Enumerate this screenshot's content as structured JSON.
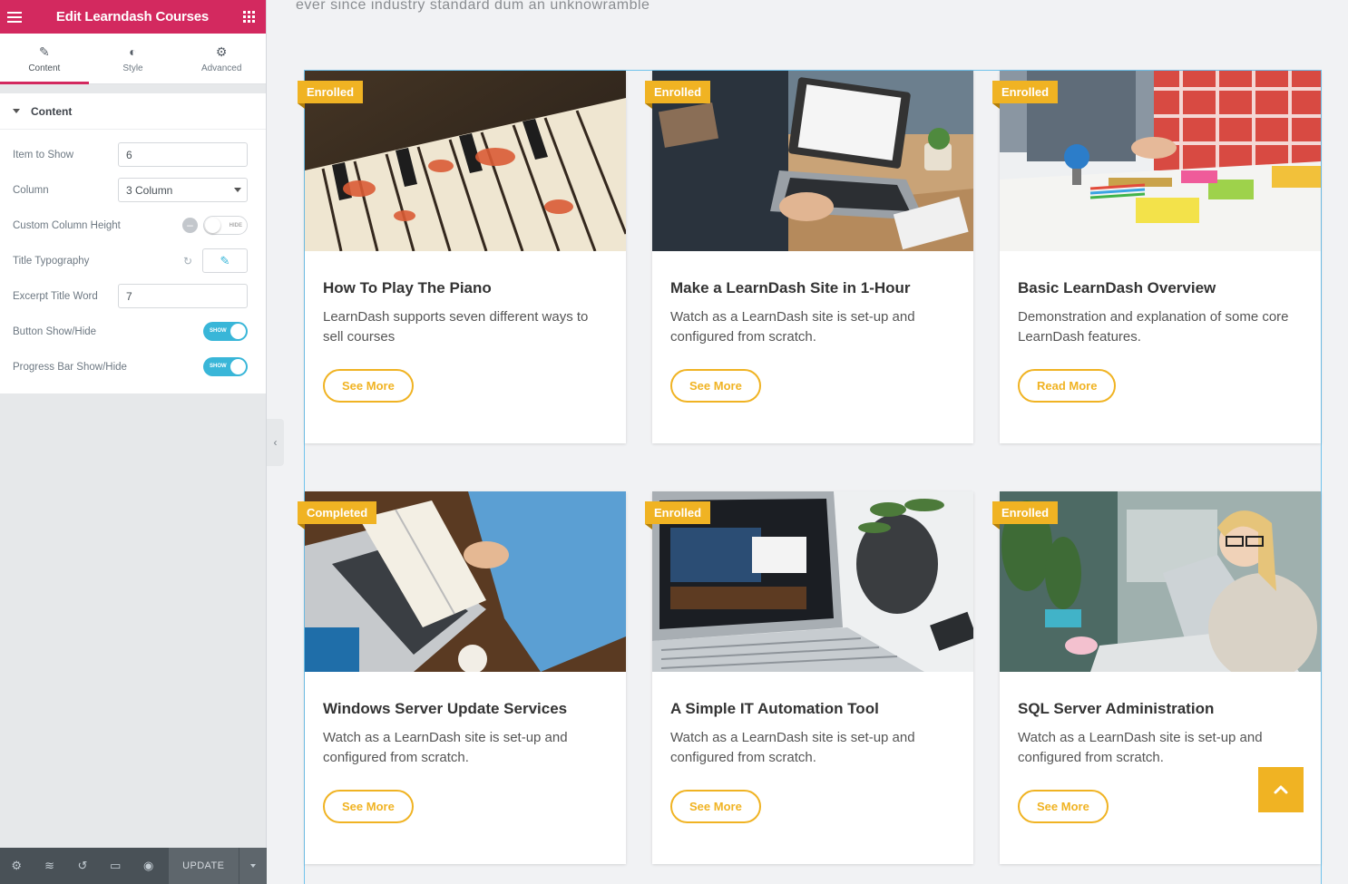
{
  "sidebar": {
    "title": "Edit Learndash Courses",
    "tabs": [
      {
        "label": "Content",
        "icon": "pencil-icon"
      },
      {
        "label": "Style",
        "icon": "contrast-icon"
      },
      {
        "label": "Advanced",
        "icon": "gear-icon"
      }
    ],
    "section_title": "Content",
    "controls": {
      "item_to_show_label": "Item to Show",
      "item_to_show_value": "6",
      "column_label": "Column",
      "column_value": "3 Column",
      "custom_height_label": "Custom Column Height",
      "custom_height_toggle": "HIDE",
      "title_typography_label": "Title Typography",
      "excerpt_label": "Excerpt Title Word",
      "excerpt_value": "7",
      "button_show_label": "Button Show/Hide",
      "button_show_toggle": "SHOW",
      "progress_show_label": "Progress Bar Show/Hide",
      "progress_show_toggle": "SHOW"
    },
    "footer": {
      "update_label": "UPDATE",
      "icons": [
        "settings-icon",
        "layers-icon",
        "history-icon",
        "responsive-icon",
        "preview-icon"
      ]
    }
  },
  "main": {
    "top_text": "ever since industry standard dum an unknowramble",
    "courses": [
      {
        "badge": "Enrolled",
        "title": "How To Play The Piano",
        "desc": "LearnDash supports seven different ways to sell courses",
        "button": "See More",
        "image": "piano-image"
      },
      {
        "badge": "Enrolled",
        "title": "Make a LearnDash Site in 1-Hour",
        "desc": "Watch as a LearnDash site is set-up and configured from scratch.",
        "button": "See More",
        "image": "laptop-desk-image"
      },
      {
        "badge": "Enrolled",
        "title": "Basic LearnDash Overview",
        "desc": "Demonstration and explanation of some core LearnDash features.",
        "button": "Read More",
        "image": "classroom-table-image"
      },
      {
        "badge": "Completed",
        "title": "Windows Server Update Services",
        "desc": "Watch as a LearnDash site is set-up and configured from scratch.",
        "button": "See More",
        "image": "book-laptop-image"
      },
      {
        "badge": "Enrolled",
        "title": "A Simple IT Automation Tool",
        "desc": "Watch as a LearnDash site is set-up and configured from scratch.",
        "button": "See More",
        "image": "laptop-screen-image"
      },
      {
        "badge": "Enrolled",
        "title": "SQL Server Administration",
        "desc": "Watch as a LearnDash site is set-up and configured from scratch.",
        "button": "See More",
        "image": "woman-laptop-image"
      }
    ]
  },
  "colors": {
    "brand": "#d3295f",
    "accent": "#f0b323",
    "toggle_on": "#39b6d8"
  }
}
